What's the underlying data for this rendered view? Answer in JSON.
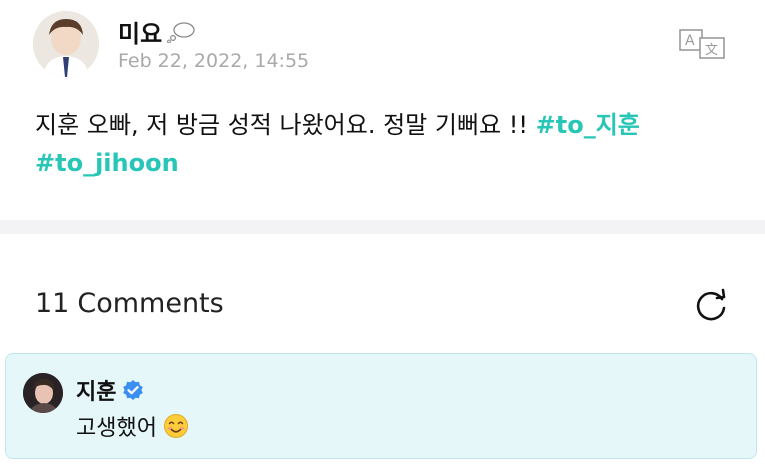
{
  "post": {
    "author_name": "미요",
    "author_status_icon": "thought-bubble-icon",
    "timestamp": "Feb 22, 2022, 14:55",
    "body_text": "지훈 오빠, 저 방금 성적 나왔어요. 정말 기뻐요 !!",
    "hashtags": [
      "#to_지훈",
      "#to_jihoon"
    ],
    "translate_icon": "translate-icon",
    "hashtag_color": "#27c6b6"
  },
  "comments": {
    "count": "11",
    "label": "Comments",
    "refresh_icon": "refresh-icon",
    "items": [
      {
        "author_name": "지훈",
        "verified_icon": "verified-badge-icon",
        "text": "고생했어",
        "emoji": "😊"
      }
    ],
    "highlight_bg": "#e6f7fa",
    "verified_color": "#3b8ff0"
  }
}
